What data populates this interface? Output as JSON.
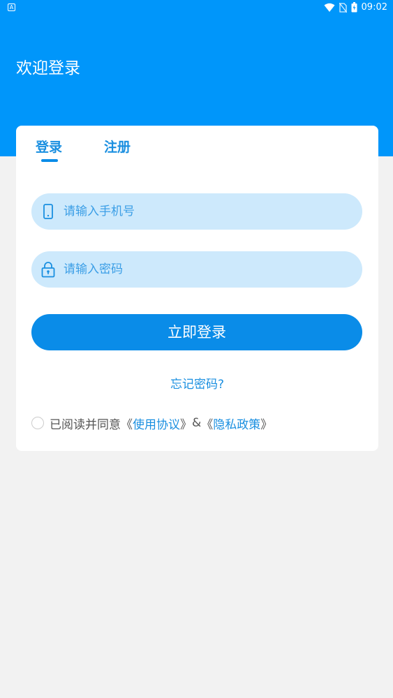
{
  "status_bar": {
    "time": "09:02",
    "left_icon": "A",
    "icons": [
      "wifi-icon",
      "no-sim-icon",
      "battery-icon"
    ]
  },
  "header": {
    "title": "欢迎登录"
  },
  "tabs": {
    "login": "登录",
    "register": "注册",
    "active": "login"
  },
  "form": {
    "phone_placeholder": "请输入手机号",
    "password_placeholder": "请输入密码",
    "submit_label": "立即登录",
    "forgot_label": "忘记密码?"
  },
  "agreement": {
    "prefix": "已阅读并同意",
    "open_quote": "《",
    "close_quote": "》",
    "terms": "使用协议",
    "and": "&",
    "privacy": "隐私政策",
    "checked": false
  },
  "colors": {
    "header_bg": "#0096fa",
    "accent": "#0a8ce8",
    "field_bg": "#cde9fc",
    "page_bg": "#f2f2f2"
  }
}
